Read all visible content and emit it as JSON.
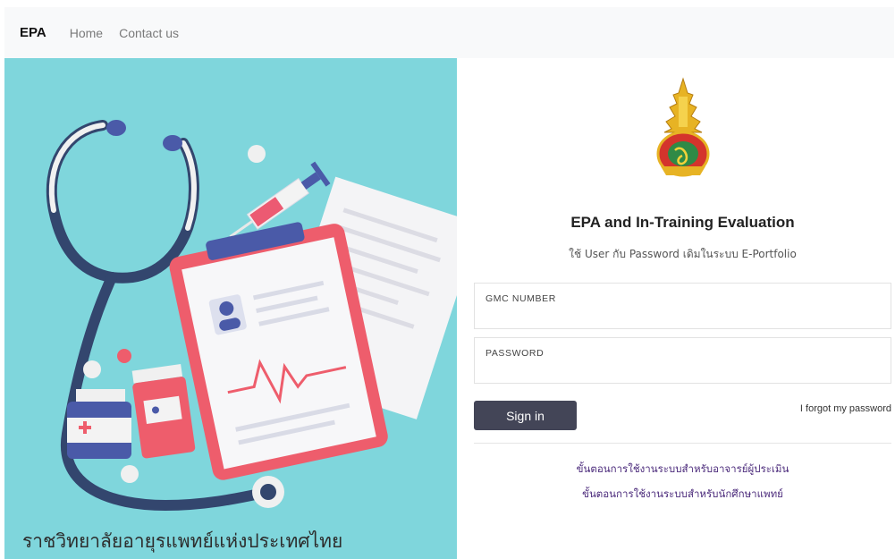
{
  "navbar": {
    "brand": "EPA",
    "links": [
      "Home",
      "Contact us"
    ]
  },
  "hero": {
    "caption": "ราชวิทยาลัยอายุรแพทย์แห่งประเทศไทย",
    "background": "#7fd6dc"
  },
  "login": {
    "title": "EPA and In-Training Evaluation",
    "subtitle": "ใช้ User กับ Password เดิมในระบบ E-Portfolio",
    "fields": {
      "gmc_label": "GMC NUMBER",
      "gmc_value": "",
      "password_label": "PASSWORD",
      "password_value": ""
    },
    "sign_in_label": "Sign in",
    "forgot_label": "I forgot my password",
    "guides": [
      "ขั้นตอนการใช้งานระบบสำหรับอาจารย์ผู้ประเมิน",
      "ขั้นตอนการใช้งานระบบสำหรับนักศึกษาแพทย์"
    ]
  },
  "colors": {
    "accent_button": "#434557",
    "guide_link": "#4b2a7b",
    "navbar_bg": "#f8f9fa"
  },
  "icons": [
    "college-emblem-icon",
    "stethoscope-illustration",
    "clipboard-icon",
    "syringe-icon",
    "medicine-bottle-icon",
    "pill-icon"
  ]
}
